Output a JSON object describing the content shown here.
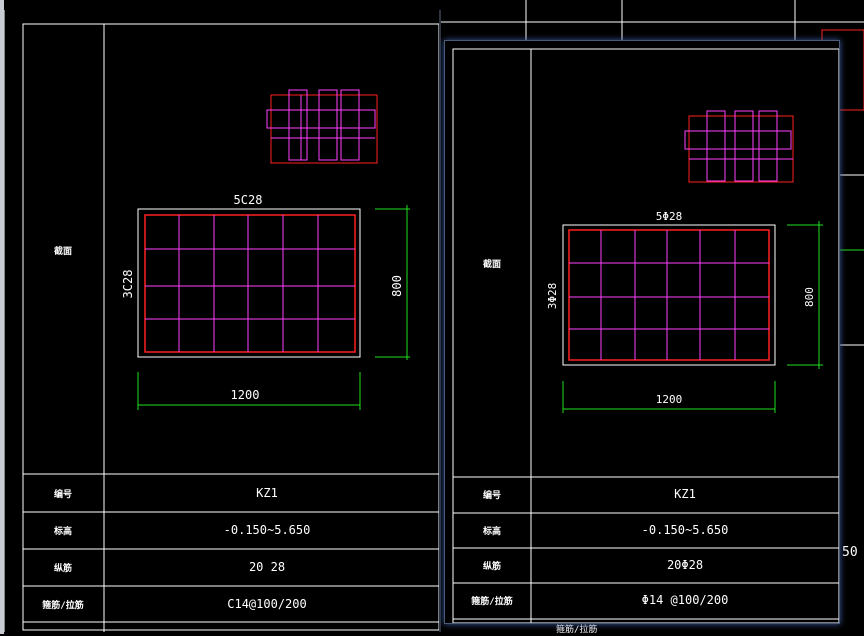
{
  "window_left": {
    "section_label": "截面",
    "top_rebar": "5C28",
    "side_rebar": "3C28",
    "dim_width": "1200",
    "dim_height": "800",
    "rows": [
      {
        "label": "编号",
        "value": "KZ1"
      },
      {
        "label": "标高",
        "value": "-0.150~5.650"
      },
      {
        "label": "纵筋",
        "value": "20 28"
      },
      {
        "label": "箍筋/拉筋",
        "value": "C14@100/200"
      }
    ]
  },
  "window_right": {
    "section_label": "截面",
    "top_rebar": "5Φ28",
    "side_rebar": "3Φ28",
    "dim_width": "1200",
    "dim_height": "800",
    "rows": [
      {
        "label": "编号",
        "value": "KZ1"
      },
      {
        "label": "标高",
        "value": "-0.150~5.650"
      },
      {
        "label": "纵筋",
        "value": "20Φ28"
      },
      {
        "label": "箍筋/拉筋",
        "value": "Φ14 @100/200"
      }
    ]
  },
  "background": {
    "peek_value": "50",
    "bottom_fragment": "箍筋/拉筋"
  },
  "colors": {
    "canvas": "#000000",
    "frame": "#ffffff",
    "stirrup": "#ff40ff",
    "rebar": "#ff2020",
    "dimension": "#20e020"
  }
}
